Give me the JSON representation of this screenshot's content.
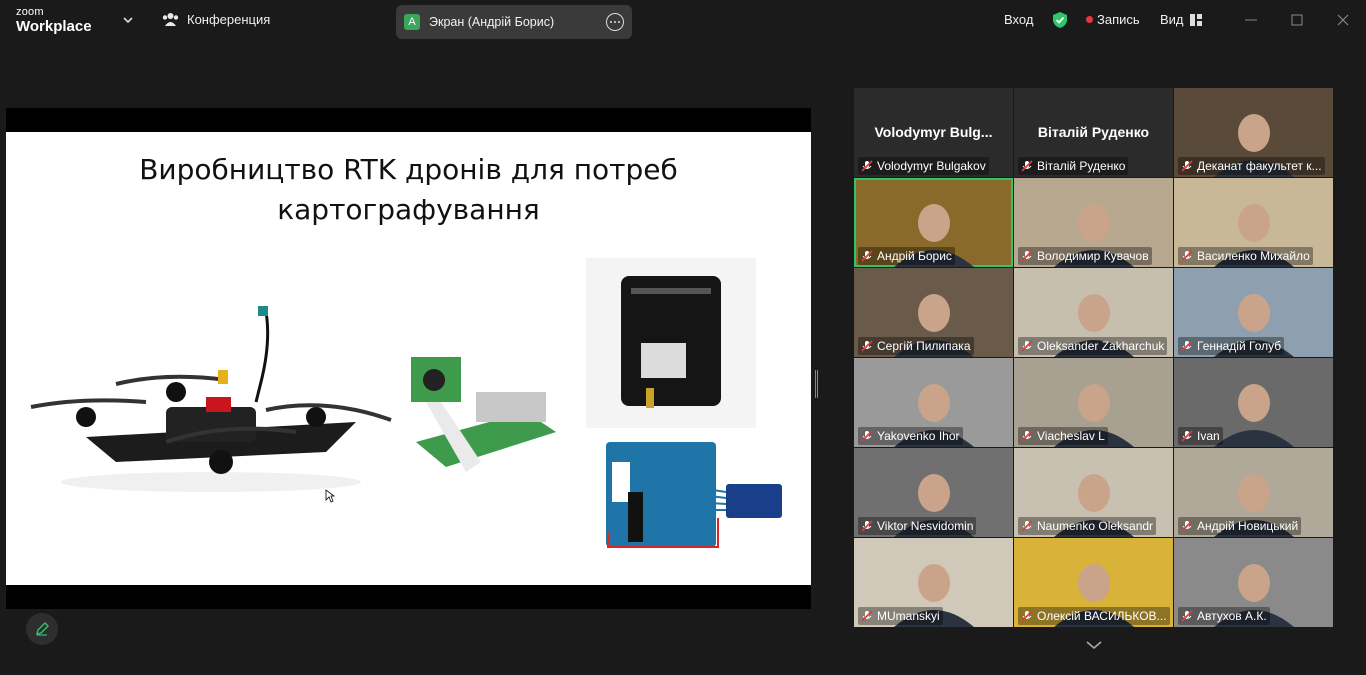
{
  "app": {
    "brand_line1": "zoom",
    "brand_line2": "Workplace"
  },
  "meeting": {
    "title": "Конференция"
  },
  "screen_share": {
    "avatar_letter": "А",
    "label": "Экран (Андрій Борис)"
  },
  "controls": {
    "signin": "Вход",
    "record": "Запись",
    "view": "Вид"
  },
  "slide": {
    "title_line1": "Виробництво RTK дронів для потреб",
    "title_line2": "картографування"
  },
  "colors": {
    "accent_green": "#2fc56a",
    "record_red": "#e5393a",
    "muted_red": "#e5393a"
  },
  "participants": [
    {
      "name": "Volodymyr Bulgakov",
      "display": "Volodymyr  Bulg...",
      "video": false
    },
    {
      "name": "Віталій Руденко",
      "display": "Віталій Руденко",
      "video": false
    },
    {
      "name": "Деканат факультет к...",
      "video": true
    },
    {
      "name": "Андрій Борис",
      "video": true,
      "active": true
    },
    {
      "name": "Володимир Кувачов",
      "video": true
    },
    {
      "name": "Василенко Михайло",
      "video": true
    },
    {
      "name": "Сергій Пилипака",
      "video": true
    },
    {
      "name": "Oleksander Zakharchuk",
      "video": true
    },
    {
      "name": "Геннадій Голуб",
      "video": true
    },
    {
      "name": "Yakovenko Ihor",
      "video": true
    },
    {
      "name": "Viacheslav L",
      "video": true
    },
    {
      "name": "Ivan",
      "video": true
    },
    {
      "name": "Viktor Nesvidomin",
      "video": true
    },
    {
      "name": "Naumenko Oleksandr",
      "video": true
    },
    {
      "name": "Андрій Новицький",
      "video": true
    },
    {
      "name": "MUmanskyi",
      "video": true
    },
    {
      "name": "Олексій ВАСИЛЬКОВ...",
      "video": true
    },
    {
      "name": "Автухов А.К.",
      "video": true
    }
  ]
}
